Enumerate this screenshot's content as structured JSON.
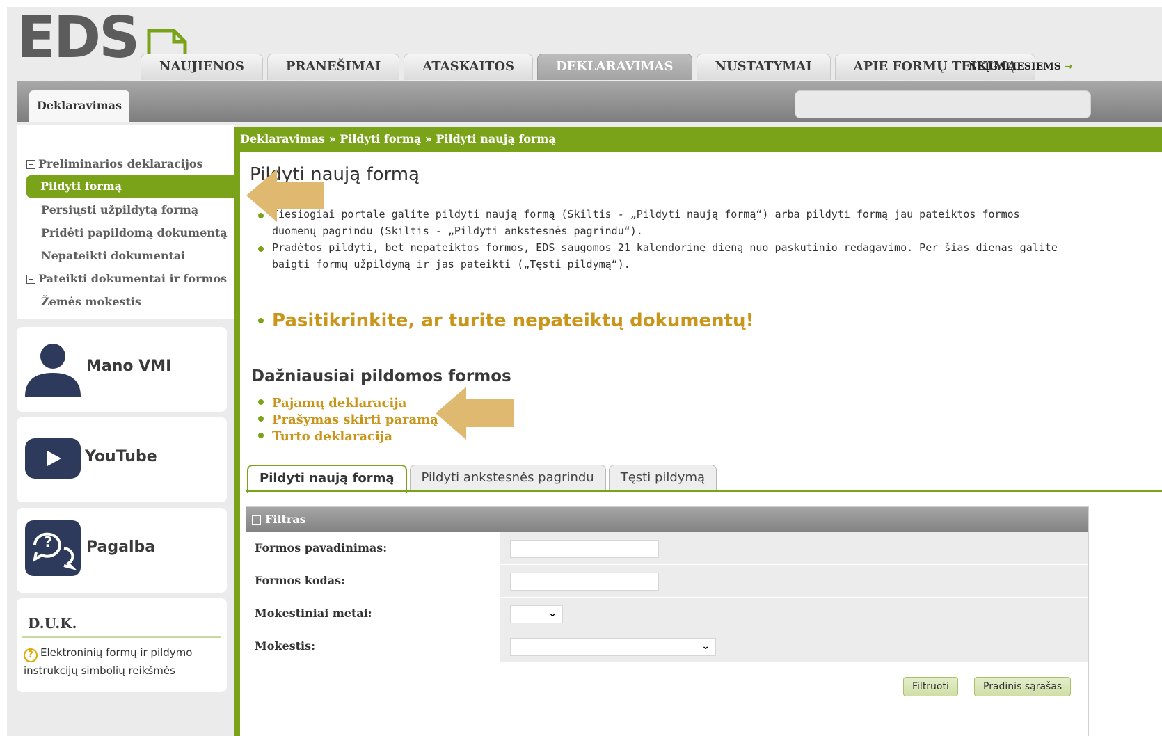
{
  "logo": {
    "text": "EDS"
  },
  "top_tabs": [
    {
      "label": "NAUJIENOS",
      "active": false
    },
    {
      "label": "PRANEŠIMAI",
      "active": false
    },
    {
      "label": "ATASKAITOS",
      "active": false
    },
    {
      "label": "DEKLARAVIMAS",
      "active": true
    },
    {
      "label": "NUSTATYMAI",
      "active": false
    },
    {
      "label": "APIE FORMŲ TEIKIMĄ",
      "active": false
    }
  ],
  "accessibility_link": {
    "label": "NEĮGALIESIEMS",
    "arrow": "→"
  },
  "sub_tab": {
    "label": "Deklaravimas"
  },
  "sidebar": {
    "items": [
      {
        "label": "Preliminarios deklaracijos",
        "expandable": true,
        "active": false
      },
      {
        "label": "Pildyti formą",
        "expandable": false,
        "active": true
      },
      {
        "label": "Persiųsti užpildytą formą",
        "expandable": false,
        "active": false
      },
      {
        "label": "Pridėti papildomą dokumentą",
        "expandable": false,
        "active": false
      },
      {
        "label": "Nepateikti dokumentai",
        "expandable": false,
        "active": false
      },
      {
        "label": "Pateikti dokumentai ir formos",
        "expandable": true,
        "active": false
      },
      {
        "label": "Žemės mokestis",
        "expandable": false,
        "active": false
      }
    ],
    "boxes": [
      {
        "label": "Mano VMI",
        "icon": "person-icon"
      },
      {
        "label": "YouTube",
        "icon": "youtube-icon"
      },
      {
        "label": "Pagalba",
        "icon": "help-chat-icon"
      }
    ],
    "faq": {
      "title": "D.U.K.",
      "link": "Elektroninių formų ir pildymo instrukcijų simbolių reikšmės"
    }
  },
  "breadcrumb": {
    "parts": [
      "Deklaravimas",
      "Pildyti formą",
      "Pildyti naują formą"
    ],
    "separator": "»"
  },
  "main": {
    "title": "Pildyti naują formą",
    "info": [
      "Tiesiogiai portale galite pildyti naują formą (Skiltis - „Pildyti naują formą“) arba pildyti formą jau pateiktos formos duomenų pagrindu (Skiltis - „Pildyti ankstesnės pagrindu“).",
      "Pradėtos pildyti, bet nepateiktos formos, EDS saugomos 21 kalendorinę dieną nuo paskutinio redagavimo. Per šias dienas galite baigti formų užpildymą ir jas pateikti („Tęsti pildymą“)."
    ],
    "check_link": "Pasitikrinkite, ar turite nepateiktų dokumentų!",
    "frequent_title": "Dažniausiai pildomos formos",
    "frequent_forms": [
      "Pajamų deklaracija",
      "Prašymas skirti paramą",
      "Turto deklaracija"
    ],
    "tabs": [
      {
        "label": "Pildyti naują formą",
        "active": true
      },
      {
        "label": "Pildyti ankstesnės pagrindu",
        "active": false
      },
      {
        "label": "Tęsti pildymą",
        "active": false
      }
    ]
  },
  "filter": {
    "title": "Filtras",
    "fields": [
      {
        "label": "Formos pavadinimas:",
        "type": "text",
        "value": ""
      },
      {
        "label": "Formos kodas:",
        "type": "text",
        "value": ""
      },
      {
        "label": "Mokestiniai metai:",
        "type": "select",
        "value": ""
      },
      {
        "label": "Mokestis:",
        "type": "select",
        "value": ""
      }
    ],
    "buttons": {
      "filter": "Filtruoti",
      "reset": "Pradinis sąrašas"
    }
  },
  "colors": {
    "accent_green": "#7aa31a",
    "link_gold": "#c9951a",
    "annotation_arrow": "#deb96f",
    "icon_navy": "#2e3a5c"
  }
}
